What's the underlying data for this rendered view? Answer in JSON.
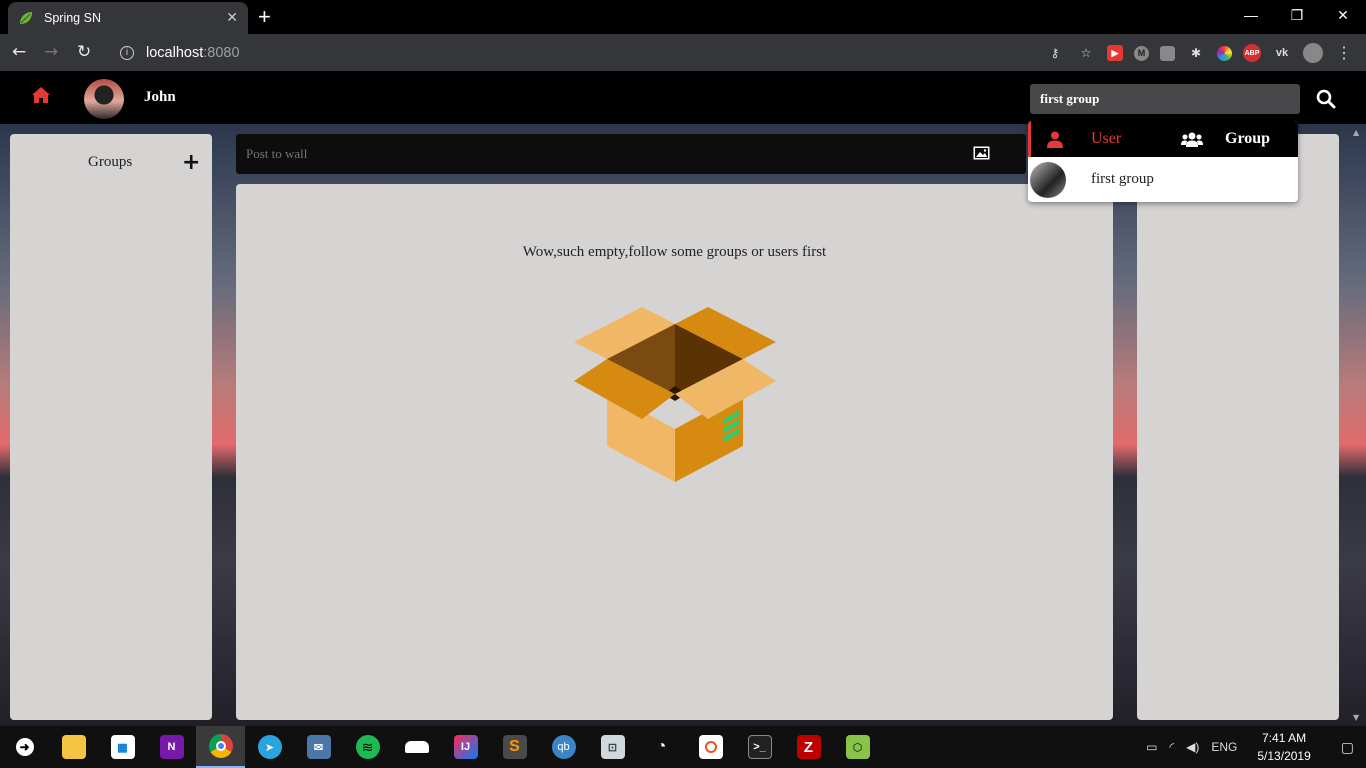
{
  "browser": {
    "tab_title": "Spring SN",
    "tab_close": "✕",
    "new_tab": "+",
    "url_host": "localhost",
    "url_port": ":8080",
    "window_controls": [
      "—",
      "❐",
      "✕"
    ]
  },
  "navbar": {
    "username": "John",
    "search_value": "first group",
    "accent": "#e53935"
  },
  "sidebar_left": {
    "title": "Groups",
    "add": "+"
  },
  "post": {
    "placeholder": "Post to wall"
  },
  "feed": {
    "empty_text": "Wow,such empty,follow some groups or users first"
  },
  "search_dropdown": {
    "tabs": [
      {
        "label": "User",
        "icon": "user-icon",
        "active": true
      },
      {
        "label": "Group",
        "icon": "users-icon",
        "active": false
      }
    ],
    "results": [
      {
        "label": "first group"
      }
    ]
  },
  "taskbar": {
    "apps": [
      "task-view",
      "file-explorer",
      "store",
      "onenote",
      "chrome",
      "telegram",
      "messenger",
      "spotify",
      "soundcloud",
      "intellij",
      "sublime",
      "qbittorrent",
      "remote-desktop",
      "speedtest",
      "ubuntu",
      "terminal",
      "filezilla",
      "sketchup"
    ],
    "language": "ENG",
    "time": "7:41 AM",
    "date": "5/13/2019"
  }
}
